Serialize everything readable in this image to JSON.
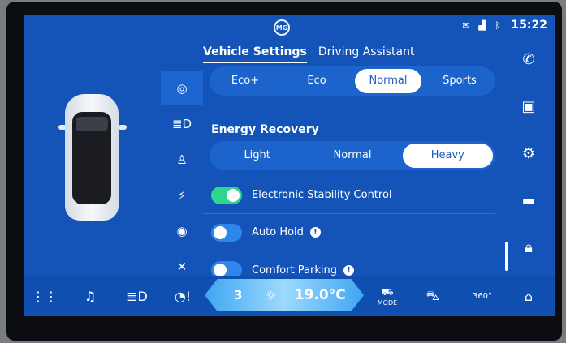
{
  "status": {
    "time": "15:22"
  },
  "tabs": [
    {
      "label": "Vehicle Settings",
      "active": true
    },
    {
      "label": "Driving Assistant",
      "active": false
    }
  ],
  "drive_mode": {
    "options": [
      "Eco+",
      "Eco",
      "Normal",
      "Sports"
    ],
    "selected": "Normal"
  },
  "energy_recovery": {
    "title": "Energy Recovery",
    "options": [
      "Light",
      "Normal",
      "Heavy"
    ],
    "selected": "Heavy"
  },
  "settings": [
    {
      "label": "Electronic Stability Control",
      "enabled": true,
      "info": false
    },
    {
      "label": "Auto Hold",
      "enabled": false,
      "info": true
    },
    {
      "label": "Comfort Parking",
      "enabled": false,
      "info": true
    }
  ],
  "climate": {
    "fan_level": "3",
    "temperature": "19.0°C"
  },
  "bottom_labels": {
    "mode": "MODE",
    "view360": "360°"
  },
  "colors": {
    "screen_bg": "#1454b8",
    "toggle_on": "#2fd58a",
    "toggle_off": "#2e86ea"
  }
}
